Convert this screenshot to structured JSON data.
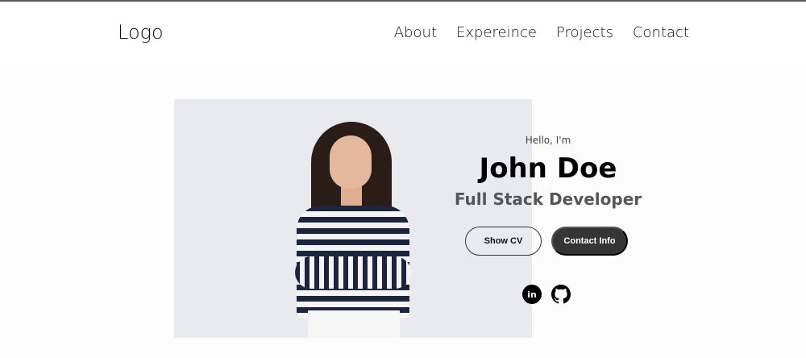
{
  "header": {
    "logo": "Logo",
    "nav": [
      "About",
      "Expereince",
      "Projects",
      "Contact"
    ]
  },
  "hero": {
    "greeting": "Hello, I'm",
    "name": "John Doe",
    "role": "Full Stack Developer",
    "show_cv": "Show CV",
    "contact_info": "Contact Info"
  },
  "social": {
    "linkedin_icon": "linkedin-icon",
    "linkedin_glyph": "in",
    "github_icon": "github-icon"
  }
}
